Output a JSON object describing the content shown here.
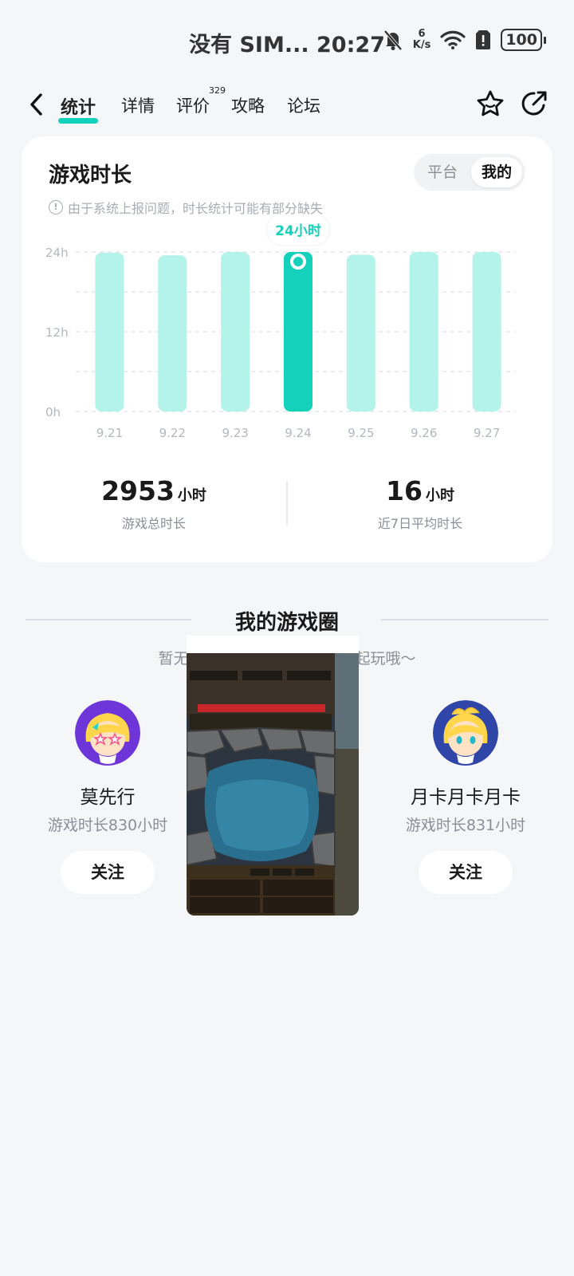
{
  "status_bar": {
    "carrier_time": "没有 SIM... 20:27",
    "net_speed_value": "6",
    "net_speed_unit": "K/s",
    "battery": "100"
  },
  "nav": {
    "tabs": [
      {
        "label": "统计",
        "active": true
      },
      {
        "label": "详情"
      },
      {
        "label": "评价",
        "badge": "329"
      },
      {
        "label": "攻略"
      },
      {
        "label": "论坛"
      }
    ]
  },
  "card": {
    "title": "游戏时长",
    "segments": [
      "平台",
      "我的"
    ],
    "selected_segment": "我的",
    "notice": "由于系统上报问题，时长统计可能有部分缺失",
    "stats": {
      "total_value": "2953",
      "total_unit": "小时",
      "total_label": "游戏总时长",
      "avg_value": "16",
      "avg_unit": "小时",
      "avg_label": "近7日平均时长"
    }
  },
  "chart_data": {
    "type": "bar",
    "categories": [
      "9.21",
      "9.22",
      "9.23",
      "9.24",
      "9.25",
      "9.26",
      "9.27"
    ],
    "values": [
      23.9,
      23.5,
      24,
      24,
      23.6,
      24,
      24
    ],
    "y_ticks": [
      "0h",
      "12h",
      "24h"
    ],
    "ylim": [
      0,
      24
    ],
    "highlight_index": 3,
    "tooltip": "24小时",
    "bar_color": "#b4f3ea",
    "highlight_color": "#14d1bb",
    "grid": true
  },
  "circle": {
    "title": "我的游戏圈",
    "subtitle": "暂无玩过的游戏，快和大家一起玩哦～",
    "players": [
      {
        "name": "莫先行",
        "time": "游戏时长830小时",
        "follow": "关注"
      },
      {
        "name": "月卡月卡月卡",
        "time": "游戏时长831小时",
        "follow": "关注"
      }
    ]
  },
  "colors": {
    "accent": "#14d1bb",
    "background": "#f5f6f8"
  }
}
